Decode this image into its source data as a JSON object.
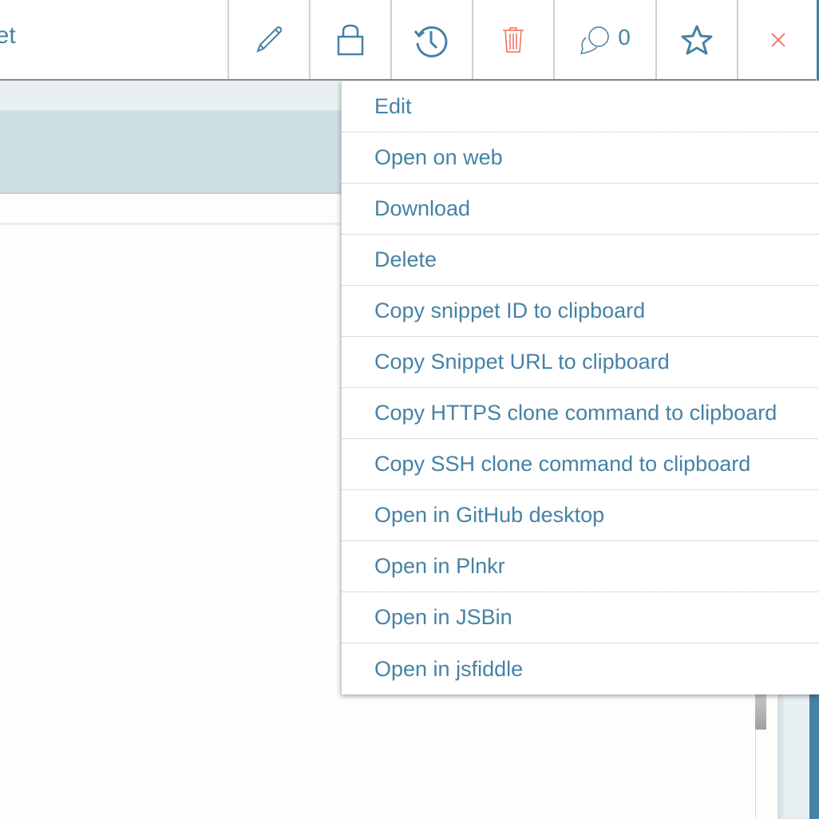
{
  "header": {
    "title": "let",
    "toolbar": {
      "edit_icon": "pencil-icon",
      "lock_icon": "lock-icon",
      "history_icon": "history-icon",
      "delete_icon": "trash-icon",
      "comments_icon": "comments-icon",
      "comments_count": "0",
      "star_icon": "star-icon",
      "close_icon": "close-icon"
    }
  },
  "colors": {
    "accent": "#4682a5",
    "danger": "#f26b5b",
    "selected_row": "#cfdfe6"
  },
  "menu": {
    "items": [
      {
        "label": "Edit"
      },
      {
        "label": "Open on web"
      },
      {
        "label": "Download"
      },
      {
        "label": "Delete"
      },
      {
        "label": "Copy snippet ID to clipboard"
      },
      {
        "label": "Copy Snippet URL to clipboard"
      },
      {
        "label": "Copy HTTPS clone command to clipboard"
      },
      {
        "label": "Copy SSH clone command to clipboard"
      },
      {
        "label": "Open in GitHub desktop"
      },
      {
        "label": "Open in Plnkr"
      },
      {
        "label": "Open in JSBin"
      },
      {
        "label": "Open in jsfiddle"
      }
    ]
  }
}
